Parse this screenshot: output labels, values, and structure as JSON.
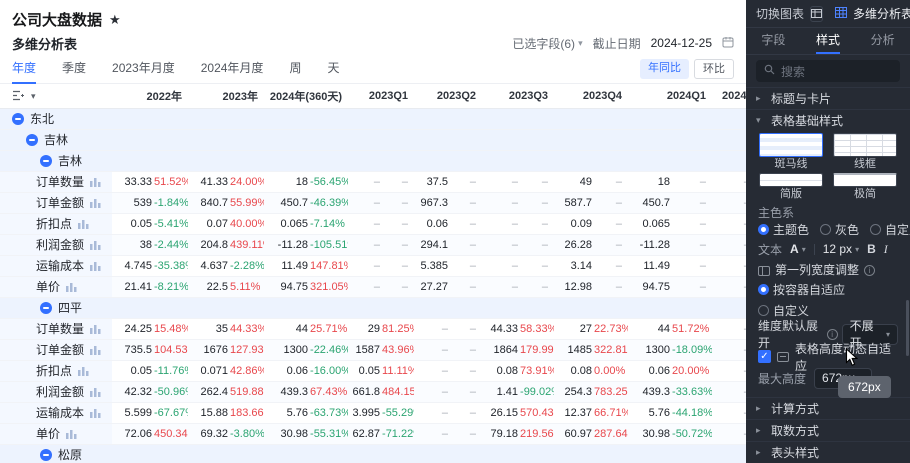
{
  "page": {
    "title": "公司大盘数据",
    "star": "★"
  },
  "panel": {
    "title": "多维分析表",
    "selected_fields": "已选字段(6)",
    "deadline_label": "截止日期",
    "deadline_date": "2024-12-25",
    "tabs": [
      {
        "label": "年度",
        "active": true
      },
      {
        "label": "季度",
        "active": false
      },
      {
        "label": "2023年月度",
        "active": false
      },
      {
        "label": "2024年月度",
        "active": false
      },
      {
        "label": "周",
        "active": false
      },
      {
        "label": "天",
        "active": false
      }
    ],
    "compare": [
      {
        "label": "年同比",
        "active": true
      },
      {
        "label": "环比",
        "active": false
      }
    ]
  },
  "table": {
    "columns": [
      "2022年",
      "2023年",
      "2024年(360天)",
      "2023Q1",
      "2023Q2",
      "2023Q3",
      "2023Q4",
      "2024Q1",
      "2024"
    ],
    "rows": [
      {
        "type": "group",
        "level": 0,
        "label": "东北"
      },
      {
        "type": "group",
        "level": 1,
        "label": "吉林"
      },
      {
        "type": "group",
        "level": 2,
        "label": "吉林"
      },
      {
        "type": "metric",
        "label": "订单数量",
        "cells": [
          [
            "33.33",
            "51.52%"
          ],
          [
            "41.33",
            "24.00%"
          ],
          [
            "18",
            "-56.45%"
          ],
          [
            "–",
            "–"
          ],
          [
            "37.5",
            "–"
          ],
          [
            "–",
            "–"
          ],
          [
            "49",
            "–"
          ],
          [
            "18",
            "–"
          ],
          [
            "–",
            "–"
          ]
        ]
      },
      {
        "type": "metric",
        "label": "订单金额",
        "cells": [
          [
            "539",
            "-1.84%"
          ],
          [
            "840.7",
            "55.99%"
          ],
          [
            "450.7",
            "-46.39%"
          ],
          [
            "–",
            "–"
          ],
          [
            "967.3",
            "–"
          ],
          [
            "–",
            "–"
          ],
          [
            "587.7",
            "–"
          ],
          [
            "450.7",
            "–"
          ],
          [
            "–",
            "–"
          ]
        ]
      },
      {
        "type": "metric",
        "label": "折扣点",
        "cells": [
          [
            "0.05",
            "-5.41%"
          ],
          [
            "0.07",
            "40.00%"
          ],
          [
            "0.065",
            "-7.14%"
          ],
          [
            "–",
            "–"
          ],
          [
            "0.06",
            "–"
          ],
          [
            "–",
            "–"
          ],
          [
            "0.09",
            "–"
          ],
          [
            "0.065",
            "–"
          ],
          [
            "–",
            "–"
          ]
        ]
      },
      {
        "type": "metric",
        "label": "利润金额",
        "cells": [
          [
            "38",
            "-2.44%"
          ],
          [
            "204.8",
            "439.11%"
          ],
          [
            "-11.28",
            "-105.51%"
          ],
          [
            "–",
            "–"
          ],
          [
            "294.1",
            "–"
          ],
          [
            "–",
            "–"
          ],
          [
            "26.28",
            "–"
          ],
          [
            "-11.28",
            "–"
          ],
          [
            "–",
            "–"
          ]
        ]
      },
      {
        "type": "metric",
        "label": "运输成本",
        "cells": [
          [
            "4.745",
            "-35.38%"
          ],
          [
            "4.637",
            "-2.28%"
          ],
          [
            "11.49",
            "147.81%"
          ],
          [
            "–",
            "–"
          ],
          [
            "5.385",
            "–"
          ],
          [
            "–",
            "–"
          ],
          [
            "3.14",
            "–"
          ],
          [
            "11.49",
            "–"
          ],
          [
            "–",
            "–"
          ]
        ]
      },
      {
        "type": "metric",
        "label": "单价",
        "cells": [
          [
            "21.41",
            "-8.21%"
          ],
          [
            "22.5",
            "5.11%"
          ],
          [
            "94.75",
            "321.05%"
          ],
          [
            "–",
            "–"
          ],
          [
            "27.27",
            "–"
          ],
          [
            "–",
            "–"
          ],
          [
            "12.98",
            "–"
          ],
          [
            "94.75",
            "–"
          ],
          [
            "–",
            "–"
          ]
        ]
      },
      {
        "type": "group",
        "level": 2,
        "label": "四平"
      },
      {
        "type": "metric",
        "label": "订单数量",
        "cells": [
          [
            "24.25",
            "15.48%"
          ],
          [
            "35",
            "44.33%"
          ],
          [
            "44",
            "25.71%"
          ],
          [
            "29",
            "81.25%"
          ],
          [
            "–",
            "–"
          ],
          [
            "44.33",
            "58.33%"
          ],
          [
            "27",
            "22.73%"
          ],
          [
            "44",
            "51.72%"
          ],
          [
            "–",
            "–"
          ]
        ]
      },
      {
        "type": "metric",
        "label": "订单金额",
        "cells": [
          [
            "735.5",
            "104.53%"
          ],
          [
            "1676",
            "127.93%"
          ],
          [
            "1300",
            "-22.46%"
          ],
          [
            "1587",
            "43.96%"
          ],
          [
            "–",
            "–"
          ],
          [
            "1864",
            "179.99%"
          ],
          [
            "1485",
            "322.81%"
          ],
          [
            "1300",
            "-18.09%"
          ],
          [
            "–",
            "–"
          ]
        ]
      },
      {
        "type": "metric",
        "label": "折扣点",
        "cells": [
          [
            "0.05",
            "-11.76%"
          ],
          [
            "0.071",
            "42.86%"
          ],
          [
            "0.06",
            "-16.00%"
          ],
          [
            "0.05",
            "11.11%"
          ],
          [
            "–",
            "–"
          ],
          [
            "0.08",
            "73.91%"
          ],
          [
            "0.08",
            "0.00%"
          ],
          [
            "0.06",
            "20.00%"
          ],
          [
            "–",
            "–"
          ]
        ]
      },
      {
        "type": "metric",
        "label": "利润金额",
        "cells": [
          [
            "42.32",
            "-50.96%"
          ],
          [
            "262.4",
            "519.88%"
          ],
          [
            "439.3",
            "67.43%"
          ],
          [
            "661.8",
            "484.15%"
          ],
          [
            "–",
            "–"
          ],
          [
            "1.41",
            "-99.02%"
          ],
          [
            "254.3",
            "783.25%"
          ],
          [
            "439.3",
            "-33.63%"
          ],
          [
            "–",
            "–"
          ]
        ]
      },
      {
        "type": "metric",
        "label": "运输成本",
        "cells": [
          [
            "5.599",
            "-67.67%"
          ],
          [
            "15.88",
            "183.66%"
          ],
          [
            "5.76",
            "-63.73%"
          ],
          [
            "3.995",
            "-55.29%"
          ],
          [
            "–",
            "–"
          ],
          [
            "26.15",
            "570.43%"
          ],
          [
            "12.37",
            "66.71%"
          ],
          [
            "5.76",
            "-44.18%"
          ],
          [
            "–",
            "–"
          ]
        ]
      },
      {
        "type": "metric",
        "label": "单价",
        "cells": [
          [
            "72.06",
            "450.34%"
          ],
          [
            "69.32",
            "-3.80%"
          ],
          [
            "30.98",
            "-55.31%"
          ],
          [
            "62.87",
            "-71.22%"
          ],
          [
            "–",
            "–"
          ],
          [
            "79.18",
            "219.56%"
          ],
          [
            "60.97",
            "287.64%"
          ],
          [
            "30.98",
            "-50.72%"
          ],
          [
            "–",
            "–"
          ]
        ]
      },
      {
        "type": "group",
        "level": 2,
        "label": "松原"
      }
    ]
  },
  "colors": {
    "accent": "#3370ff",
    "up_red": "#e8474c",
    "down_green": "#2ba471",
    "sidebar_bg": "#262b34",
    "group_row_bg": "#edf3fe"
  },
  "sidebar": {
    "switch_label": "切换图表",
    "chart_name": "多维分析表",
    "tabs": [
      {
        "label": "字段",
        "active": false
      },
      {
        "label": "样式",
        "active": true
      },
      {
        "label": "分析",
        "active": false
      }
    ],
    "search_placeholder": "搜索",
    "section_title_card": "标题与卡片",
    "style_section": {
      "title": "表格基础样式",
      "thumbs": [
        {
          "label": "斑马线",
          "selected": true
        },
        {
          "label": "线框",
          "selected": false
        },
        {
          "label": "简版",
          "selected": false
        },
        {
          "label": "极简",
          "selected": false
        }
      ],
      "color_label": "主色系",
      "color_options": [
        {
          "label": "主题色",
          "selected": true
        },
        {
          "label": "灰色",
          "selected": false
        },
        {
          "label": "自定义",
          "selected": false
        }
      ],
      "text_label": "文本",
      "font_letter": "A",
      "font_size": "12 px",
      "bold_label": "B",
      "italic_label": "I",
      "first_col_label": "第一列宽度调整",
      "width_options": [
        {
          "label": "按容器自适应",
          "selected": true
        },
        {
          "label": "自定义",
          "selected": false
        }
      ],
      "dim_expand_label": "维度默认展开",
      "dim_expand_value": "不展开",
      "auto_height_label": "表格高度动态自适应",
      "auto_height_checked": true,
      "max_height_label": "最大高度",
      "max_height_value": "672px",
      "tooltip_text": "672px"
    },
    "bottom_sections": [
      "计算方式",
      "取数方式",
      "表头样式"
    ]
  }
}
